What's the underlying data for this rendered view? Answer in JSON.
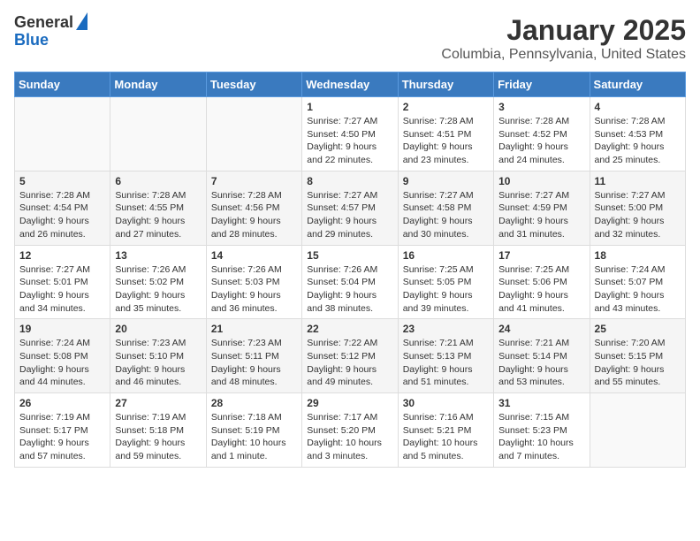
{
  "header": {
    "logo_line1": "General",
    "logo_line2": "Blue",
    "title": "January 2025",
    "subtitle": "Columbia, Pennsylvania, United States"
  },
  "calendar": {
    "days_of_week": [
      "Sunday",
      "Monday",
      "Tuesday",
      "Wednesday",
      "Thursday",
      "Friday",
      "Saturday"
    ],
    "weeks": [
      [
        {
          "day": "",
          "info": ""
        },
        {
          "day": "",
          "info": ""
        },
        {
          "day": "",
          "info": ""
        },
        {
          "day": "1",
          "info": "Sunrise: 7:27 AM\nSunset: 4:50 PM\nDaylight: 9 hours\nand 22 minutes."
        },
        {
          "day": "2",
          "info": "Sunrise: 7:28 AM\nSunset: 4:51 PM\nDaylight: 9 hours\nand 23 minutes."
        },
        {
          "day": "3",
          "info": "Sunrise: 7:28 AM\nSunset: 4:52 PM\nDaylight: 9 hours\nand 24 minutes."
        },
        {
          "day": "4",
          "info": "Sunrise: 7:28 AM\nSunset: 4:53 PM\nDaylight: 9 hours\nand 25 minutes."
        }
      ],
      [
        {
          "day": "5",
          "info": "Sunrise: 7:28 AM\nSunset: 4:54 PM\nDaylight: 9 hours\nand 26 minutes."
        },
        {
          "day": "6",
          "info": "Sunrise: 7:28 AM\nSunset: 4:55 PM\nDaylight: 9 hours\nand 27 minutes."
        },
        {
          "day": "7",
          "info": "Sunrise: 7:28 AM\nSunset: 4:56 PM\nDaylight: 9 hours\nand 28 minutes."
        },
        {
          "day": "8",
          "info": "Sunrise: 7:27 AM\nSunset: 4:57 PM\nDaylight: 9 hours\nand 29 minutes."
        },
        {
          "day": "9",
          "info": "Sunrise: 7:27 AM\nSunset: 4:58 PM\nDaylight: 9 hours\nand 30 minutes."
        },
        {
          "day": "10",
          "info": "Sunrise: 7:27 AM\nSunset: 4:59 PM\nDaylight: 9 hours\nand 31 minutes."
        },
        {
          "day": "11",
          "info": "Sunrise: 7:27 AM\nSunset: 5:00 PM\nDaylight: 9 hours\nand 32 minutes."
        }
      ],
      [
        {
          "day": "12",
          "info": "Sunrise: 7:27 AM\nSunset: 5:01 PM\nDaylight: 9 hours\nand 34 minutes."
        },
        {
          "day": "13",
          "info": "Sunrise: 7:26 AM\nSunset: 5:02 PM\nDaylight: 9 hours\nand 35 minutes."
        },
        {
          "day": "14",
          "info": "Sunrise: 7:26 AM\nSunset: 5:03 PM\nDaylight: 9 hours\nand 36 minutes."
        },
        {
          "day": "15",
          "info": "Sunrise: 7:26 AM\nSunset: 5:04 PM\nDaylight: 9 hours\nand 38 minutes."
        },
        {
          "day": "16",
          "info": "Sunrise: 7:25 AM\nSunset: 5:05 PM\nDaylight: 9 hours\nand 39 minutes."
        },
        {
          "day": "17",
          "info": "Sunrise: 7:25 AM\nSunset: 5:06 PM\nDaylight: 9 hours\nand 41 minutes."
        },
        {
          "day": "18",
          "info": "Sunrise: 7:24 AM\nSunset: 5:07 PM\nDaylight: 9 hours\nand 43 minutes."
        }
      ],
      [
        {
          "day": "19",
          "info": "Sunrise: 7:24 AM\nSunset: 5:08 PM\nDaylight: 9 hours\nand 44 minutes."
        },
        {
          "day": "20",
          "info": "Sunrise: 7:23 AM\nSunset: 5:10 PM\nDaylight: 9 hours\nand 46 minutes."
        },
        {
          "day": "21",
          "info": "Sunrise: 7:23 AM\nSunset: 5:11 PM\nDaylight: 9 hours\nand 48 minutes."
        },
        {
          "day": "22",
          "info": "Sunrise: 7:22 AM\nSunset: 5:12 PM\nDaylight: 9 hours\nand 49 minutes."
        },
        {
          "day": "23",
          "info": "Sunrise: 7:21 AM\nSunset: 5:13 PM\nDaylight: 9 hours\nand 51 minutes."
        },
        {
          "day": "24",
          "info": "Sunrise: 7:21 AM\nSunset: 5:14 PM\nDaylight: 9 hours\nand 53 minutes."
        },
        {
          "day": "25",
          "info": "Sunrise: 7:20 AM\nSunset: 5:15 PM\nDaylight: 9 hours\nand 55 minutes."
        }
      ],
      [
        {
          "day": "26",
          "info": "Sunrise: 7:19 AM\nSunset: 5:17 PM\nDaylight: 9 hours\nand 57 minutes."
        },
        {
          "day": "27",
          "info": "Sunrise: 7:19 AM\nSunset: 5:18 PM\nDaylight: 9 hours\nand 59 minutes."
        },
        {
          "day": "28",
          "info": "Sunrise: 7:18 AM\nSunset: 5:19 PM\nDaylight: 10 hours\nand 1 minute."
        },
        {
          "day": "29",
          "info": "Sunrise: 7:17 AM\nSunset: 5:20 PM\nDaylight: 10 hours\nand 3 minutes."
        },
        {
          "day": "30",
          "info": "Sunrise: 7:16 AM\nSunset: 5:21 PM\nDaylight: 10 hours\nand 5 minutes."
        },
        {
          "day": "31",
          "info": "Sunrise: 7:15 AM\nSunset: 5:23 PM\nDaylight: 10 hours\nand 7 minutes."
        },
        {
          "day": "",
          "info": ""
        }
      ]
    ]
  }
}
